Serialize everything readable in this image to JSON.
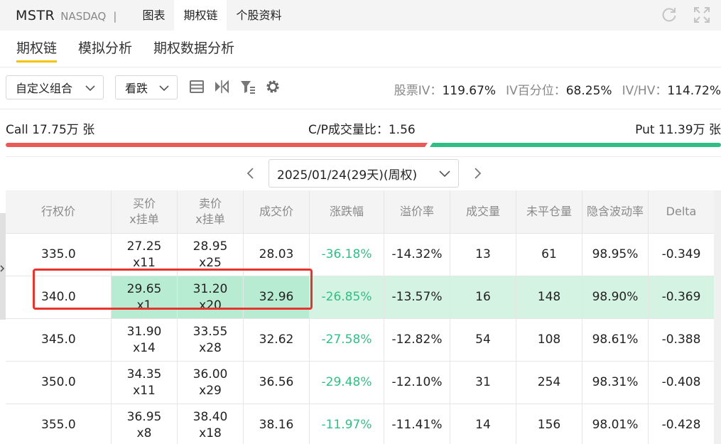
{
  "header": {
    "ticker": "MSTR",
    "exchange": "NASDAQ",
    "separator": "|",
    "tabs": [
      {
        "label": "图表",
        "active": false
      },
      {
        "label": "期权链",
        "active": true
      },
      {
        "label": "个股资料",
        "active": false
      }
    ],
    "icons": [
      "refresh-icon",
      "expand-icon"
    ]
  },
  "subtabs": [
    {
      "label": "期权链",
      "active": true
    },
    {
      "label": "模拟分析",
      "active": false
    },
    {
      "label": "期权数据分析",
      "active": false
    }
  ],
  "toolbar": {
    "combo_select": "自定义组合",
    "direction_select": "看跌",
    "icons": [
      "list-view-icon",
      "split-view-icon",
      "filter-icon",
      "gear-icon"
    ],
    "iv_label": "股票IV：",
    "iv_value": "119.67%",
    "ivpct_label": "IV百分位：",
    "ivpct_value": "68.25%",
    "ivhv_label": "IV/HV：",
    "ivhv_value": "114.72%"
  },
  "volume": {
    "call_text": "Call 17.75万 张",
    "ratio_text": "C/P成交量比：1.56",
    "put_text": "Put 11.39万 张",
    "call_color": "#ea5a57",
    "put_color": "#2fbf84"
  },
  "expiry": {
    "selected": "2025/01/24(29天)(周权)"
  },
  "table": {
    "headers": [
      {
        "line1": "行权价",
        "line2": ""
      },
      {
        "line1": "买价",
        "line2": "x挂单"
      },
      {
        "line1": "卖价",
        "line2": "x挂单"
      },
      {
        "line1": "成交价",
        "line2": ""
      },
      {
        "line1": "涨跌幅",
        "line2": ""
      },
      {
        "line1": "溢价率",
        "line2": ""
      },
      {
        "line1": "成交量",
        "line2": ""
      },
      {
        "line1": "未平仓量",
        "line2": ""
      },
      {
        "line1": "隐含波动率",
        "line2": ""
      },
      {
        "line1": "Delta",
        "line2": ""
      }
    ],
    "rows": [
      {
        "strike": "335.0",
        "bid": "27.25",
        "bid_size": "x11",
        "ask": "28.95",
        "ask_size": "x25",
        "last": "28.03",
        "change": "-36.18%",
        "premium": "-14.32%",
        "volume": "13",
        "oi": "61",
        "iv": "98.95%",
        "delta": "-0.349"
      },
      {
        "strike": "340.0",
        "bid": "29.65",
        "bid_size": "x1",
        "ask": "31.20",
        "ask_size": "x20",
        "last": "32.96",
        "change": "-26.85%",
        "premium": "-13.57%",
        "volume": "16",
        "oi": "148",
        "iv": "98.90%",
        "delta": "-0.369"
      },
      {
        "strike": "345.0",
        "bid": "31.90",
        "bid_size": "x14",
        "ask": "33.55",
        "ask_size": "x28",
        "last": "32.62",
        "change": "-27.58%",
        "premium": "-12.82%",
        "volume": "54",
        "oi": "108",
        "iv": "98.61%",
        "delta": "-0.388"
      },
      {
        "strike": "350.0",
        "bid": "34.35",
        "bid_size": "x11",
        "ask": "36.00",
        "ask_size": "x29",
        "last": "36.56",
        "change": "-29.48%",
        "premium": "-12.10%",
        "volume": "31",
        "oi": "254",
        "iv": "98.31%",
        "delta": "-0.408"
      },
      {
        "strike": "355.0",
        "bid": "36.95",
        "bid_size": "x8",
        "ask": "38.40",
        "ask_size": "x18",
        "last": "38.16",
        "change": "-11.97%",
        "premium": "-11.41%",
        "volume": "14",
        "oi": "156",
        "iv": "98.01%",
        "delta": "-0.428"
      }
    ],
    "highlight_color": "#d4f3e3",
    "change_color": "#2fbf84"
  }
}
